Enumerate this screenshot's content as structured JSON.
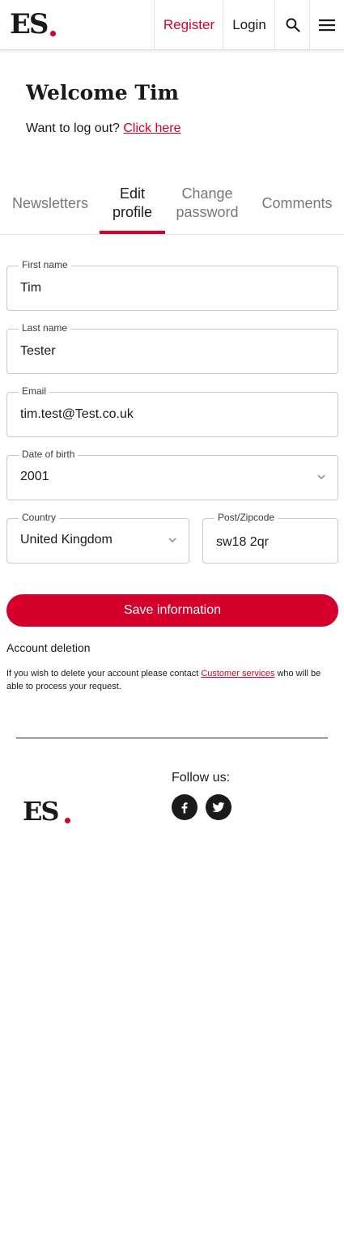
{
  "header": {
    "logo_text": "ES",
    "register_label": "Register",
    "login_label": "Login",
    "search_icon": "search-icon",
    "menu_icon": "hamburger-menu-icon"
  },
  "welcome": {
    "title": "Welcome Tim",
    "logout_prompt": "Want to log out?",
    "logout_link": "Click here"
  },
  "tabs": [
    {
      "line1": "Newsletters",
      "line2": "",
      "active": false
    },
    {
      "line1": "Edit",
      "line2": "profile",
      "active": true
    },
    {
      "line1": "Change",
      "line2": "password",
      "active": false
    },
    {
      "line1": "Comments",
      "line2": "",
      "active": false
    }
  ],
  "form": {
    "first_name": {
      "label": "First name",
      "value": "Tim"
    },
    "last_name": {
      "label": "Last name",
      "value": "Tester"
    },
    "email": {
      "label": "Email",
      "value": "tim.test@Test.co.uk"
    },
    "dob": {
      "label": "Date of birth",
      "value": "2001"
    },
    "country": {
      "label": "Country",
      "value": "United Kingdom"
    },
    "postcode": {
      "label": "Post/Zipcode",
      "value": "sw18 2qr"
    },
    "save_label": "Save information"
  },
  "account_deletion": {
    "title": "Account deletion",
    "text_before": "If you wish to delete your account please contact ",
    "link": "Customer services",
    "text_after": " who will be able to process your request."
  },
  "footer": {
    "logo_text": "ES",
    "follow_label": "Follow us:",
    "social": [
      "facebook-icon",
      "twitter-icon"
    ]
  },
  "colors": {
    "accent": "#d4002b",
    "text": "#1a1a1a",
    "muted": "#777777"
  }
}
